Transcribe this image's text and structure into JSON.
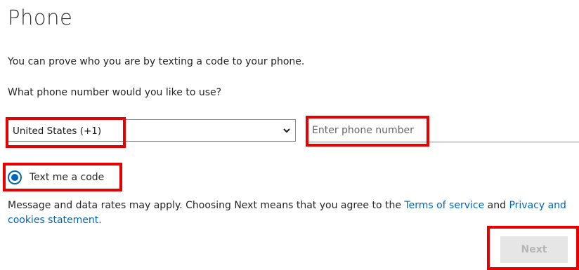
{
  "header": {
    "title": "Phone"
  },
  "intro_text": "You can prove who you are by texting a code to your phone.",
  "question_text": "What phone number would you like to use?",
  "country_select": {
    "selected": "United States (+1)",
    "icon": "chevron-down-icon"
  },
  "phone_input": {
    "placeholder": "Enter phone number",
    "value": ""
  },
  "method_option": {
    "label": "Text me a code",
    "selected": true
  },
  "disclaimer": {
    "prefix": "Message and data rates may apply. Choosing Next means that you agree to the ",
    "terms_link": "Terms of service",
    "middle": " and ",
    "privacy_link": "Privacy and cookies statement."
  },
  "next_button": {
    "label": "Next",
    "enabled": false
  },
  "colors": {
    "accent": "#0067b8",
    "highlight": "#e60000",
    "disabled_bg": "#e6e6e6",
    "disabled_text": "#b4b4b4"
  }
}
